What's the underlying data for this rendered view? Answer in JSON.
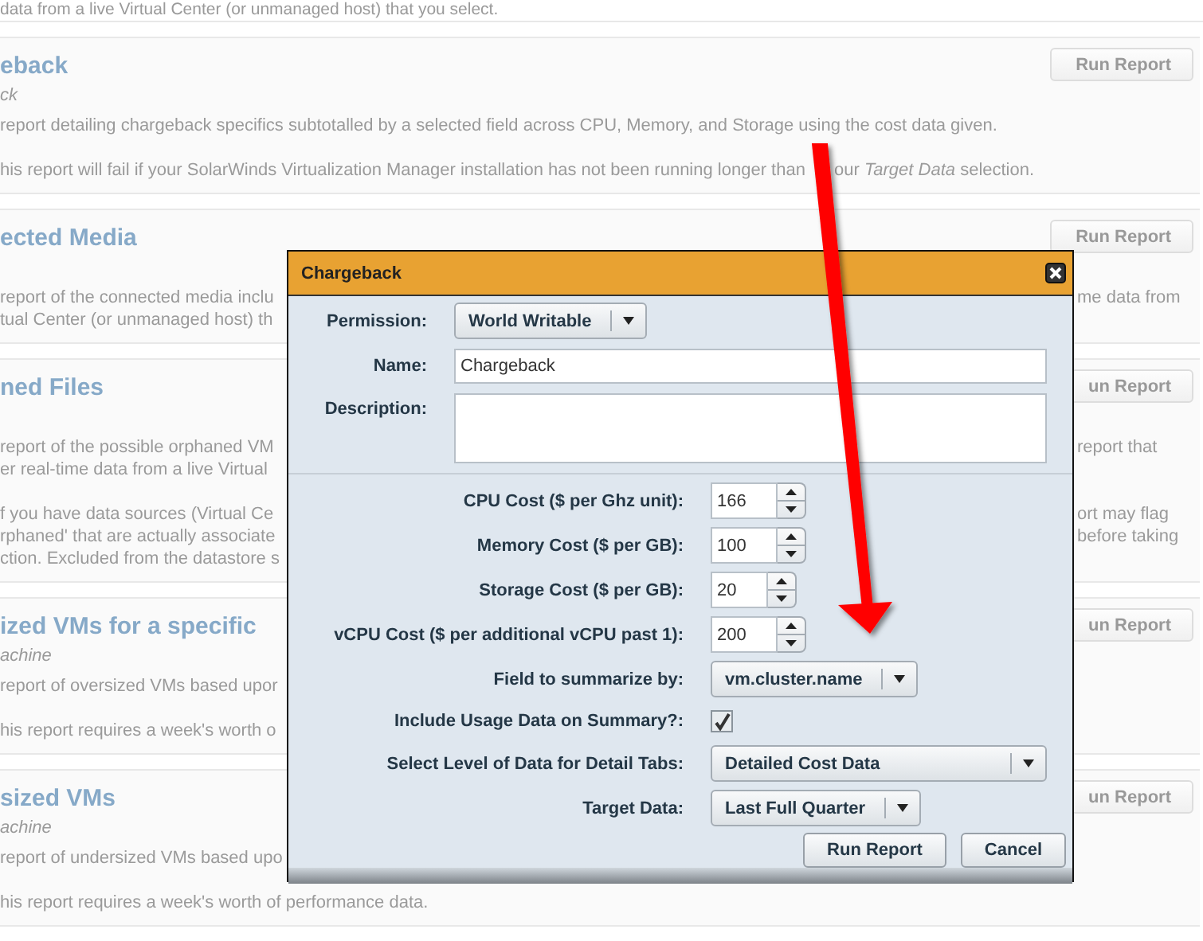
{
  "background": {
    "top_line": "data from a live Virtual Center (or unmanaged host) that you select.",
    "reports": [
      {
        "title": "eback",
        "subtitle": "ck",
        "button": "Run Report",
        "paragraphs": [
          [
            {
              "left": "report detailing chargeback specifics subtotalled by a selected field across CPU, Memory, and Storage using the cost data given."
            }
          ],
          [
            {
              "left": "his report will fail if your SolarWinds Virtualization Manager installation has not been running longer than",
              "after_arrow": "our *Target Data* selection."
            }
          ]
        ]
      },
      {
        "title": "ected Media",
        "button": "Run Report",
        "paragraphs": [
          [
            {
              "left": "report of the connected media inclu",
              "right": "me data from"
            },
            {
              "left": "tual Center (or unmanaged host) th"
            }
          ]
        ]
      },
      {
        "title": "ned Files",
        "button": "un Report",
        "paragraphs": [
          [
            {
              "left": "report of the possible orphaned VM",
              "right": "report that"
            },
            {
              "left": "er real-time data from a live Virtual"
            }
          ],
          [
            {
              "left": "f you have data sources (Virtual Ce",
              "right": "ort may flag"
            },
            {
              "left": "rphaned' that are actually associate",
              "right": "before taking"
            },
            {
              "left": "ction. Excluded from the datastore s"
            }
          ]
        ]
      },
      {
        "title": "ized VMs for a specific",
        "subtitle": "achine",
        "button": "un Report",
        "paragraphs": [
          [
            {
              "left": "report of oversized VMs based upor"
            }
          ],
          [
            {
              "left": "his report requires a week's worth o"
            }
          ]
        ]
      },
      {
        "title": "sized VMs",
        "subtitle": "achine",
        "button": "un Report",
        "paragraphs": [
          [
            {
              "left": "report of undersized VMs based upo"
            }
          ],
          [
            {
              "left": "his report requires a week's worth of performance data."
            }
          ]
        ]
      }
    ]
  },
  "dialog": {
    "title": "Chargeback",
    "top_fields": [
      {
        "kind": "select",
        "label": "Permission:",
        "value": "World Writable"
      },
      {
        "kind": "text",
        "label": "Name:",
        "value": "Chargeback"
      },
      {
        "kind": "textarea",
        "label": "Description:"
      }
    ],
    "fields": [
      {
        "kind": "spinner",
        "label": "CPU Cost ($ per Ghz unit):",
        "value": "166"
      },
      {
        "kind": "spinner",
        "label": "Memory Cost ($ per GB):",
        "value": "100"
      },
      {
        "kind": "spinner",
        "label": "Storage Cost ($ per GB):",
        "value": "20"
      },
      {
        "kind": "spinner",
        "label": "vCPU Cost ($ per additional vCPU past 1):",
        "value": "200"
      },
      {
        "kind": "select",
        "label": "Field to summarize by:",
        "value": "vm.cluster.name"
      },
      {
        "kind": "checkbox",
        "label": "Include Usage Data on Summary?:",
        "checked": true
      },
      {
        "kind": "select",
        "label": "Select Level of Data for Detail Tabs:",
        "value": "Detailed Cost Data",
        "wide": true
      },
      {
        "kind": "select",
        "label": "Target Data:",
        "value": "Last Full Quarter"
      }
    ],
    "buttons": [
      "Run Report",
      "Cancel"
    ]
  }
}
